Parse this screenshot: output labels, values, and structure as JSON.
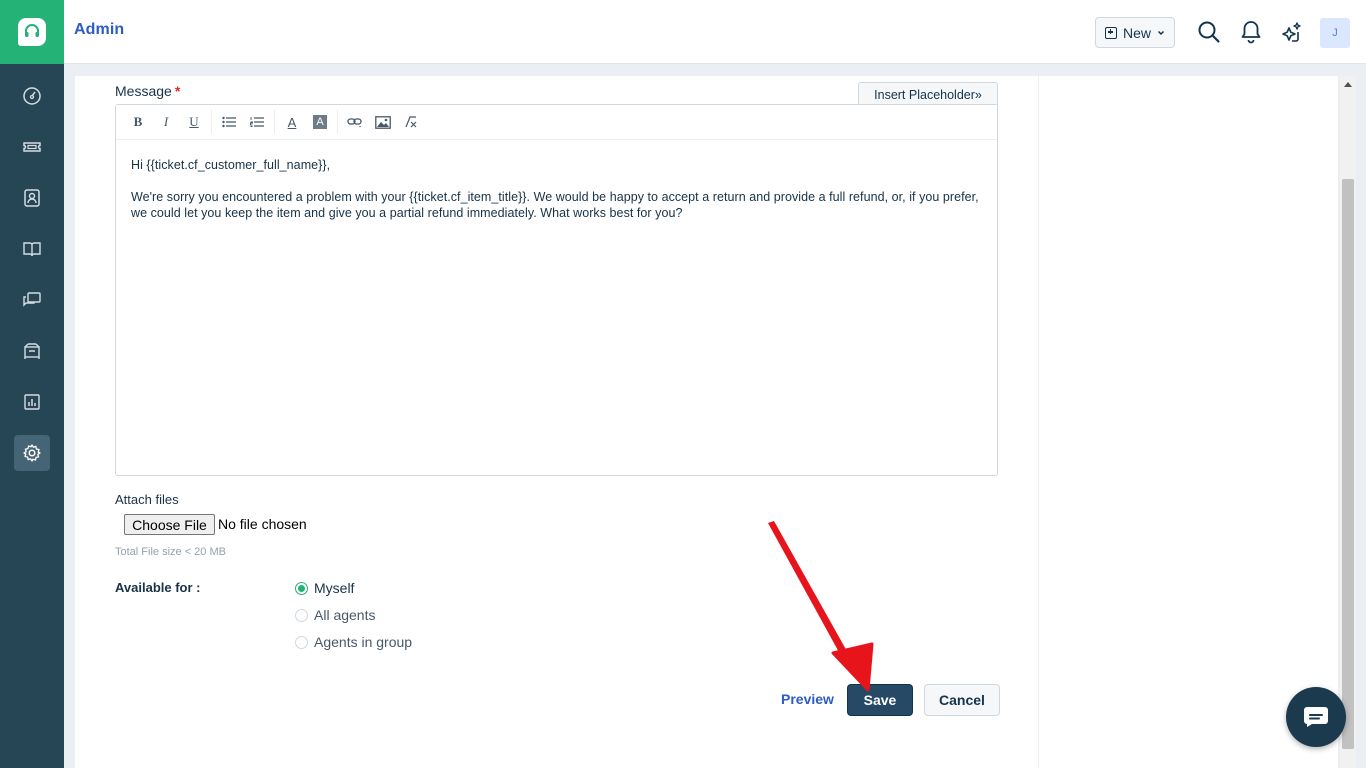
{
  "header": {
    "title": "Admin",
    "new_button_label": "New",
    "avatar_initial": "J"
  },
  "form": {
    "message_label": "Message",
    "required_marker": "*",
    "insert_placeholder_label": "Insert Placeholder»",
    "toolbar": {
      "bold": "B",
      "italic": "I",
      "underline": "U",
      "font_color": "A",
      "bg_color": "A"
    },
    "message_lines": [
      "Hi {{ticket.cf_customer_full_name}},",
      "We're sorry you encountered a problem with your {{ticket.cf_item_title}}. We would be happy to accept a return and provide a full refund, or, if you prefer, we could let you keep the item and give you a partial refund immediately. What works best for you?"
    ],
    "attach_label": "Attach files",
    "choose_file_label": "Choose File",
    "no_file_text": "No file chosen",
    "file_size_note": "Total File size < 20 MB",
    "available_for_label": "Available for :",
    "visibility_options": [
      {
        "label": "Myself",
        "selected": true
      },
      {
        "label": "All agents",
        "selected": false
      },
      {
        "label": "Agents in group",
        "selected": false
      }
    ],
    "preview_label": "Preview",
    "save_label": "Save",
    "cancel_label": "Cancel"
  },
  "colors": {
    "sidebar": "#264555",
    "brand_green": "#25b277",
    "link_blue": "#2c5cc5",
    "primary_button": "#264966",
    "annotation_arrow": "#e8141c"
  },
  "icons": {
    "sidebar": [
      "dashboard-icon",
      "tickets-icon",
      "contacts-icon",
      "solutions-icon",
      "forums-icon",
      "groups-icon",
      "reports-icon",
      "admin-gear-icon"
    ],
    "header": [
      "search-icon",
      "bell-icon",
      "sparkle-ai-icon"
    ]
  }
}
